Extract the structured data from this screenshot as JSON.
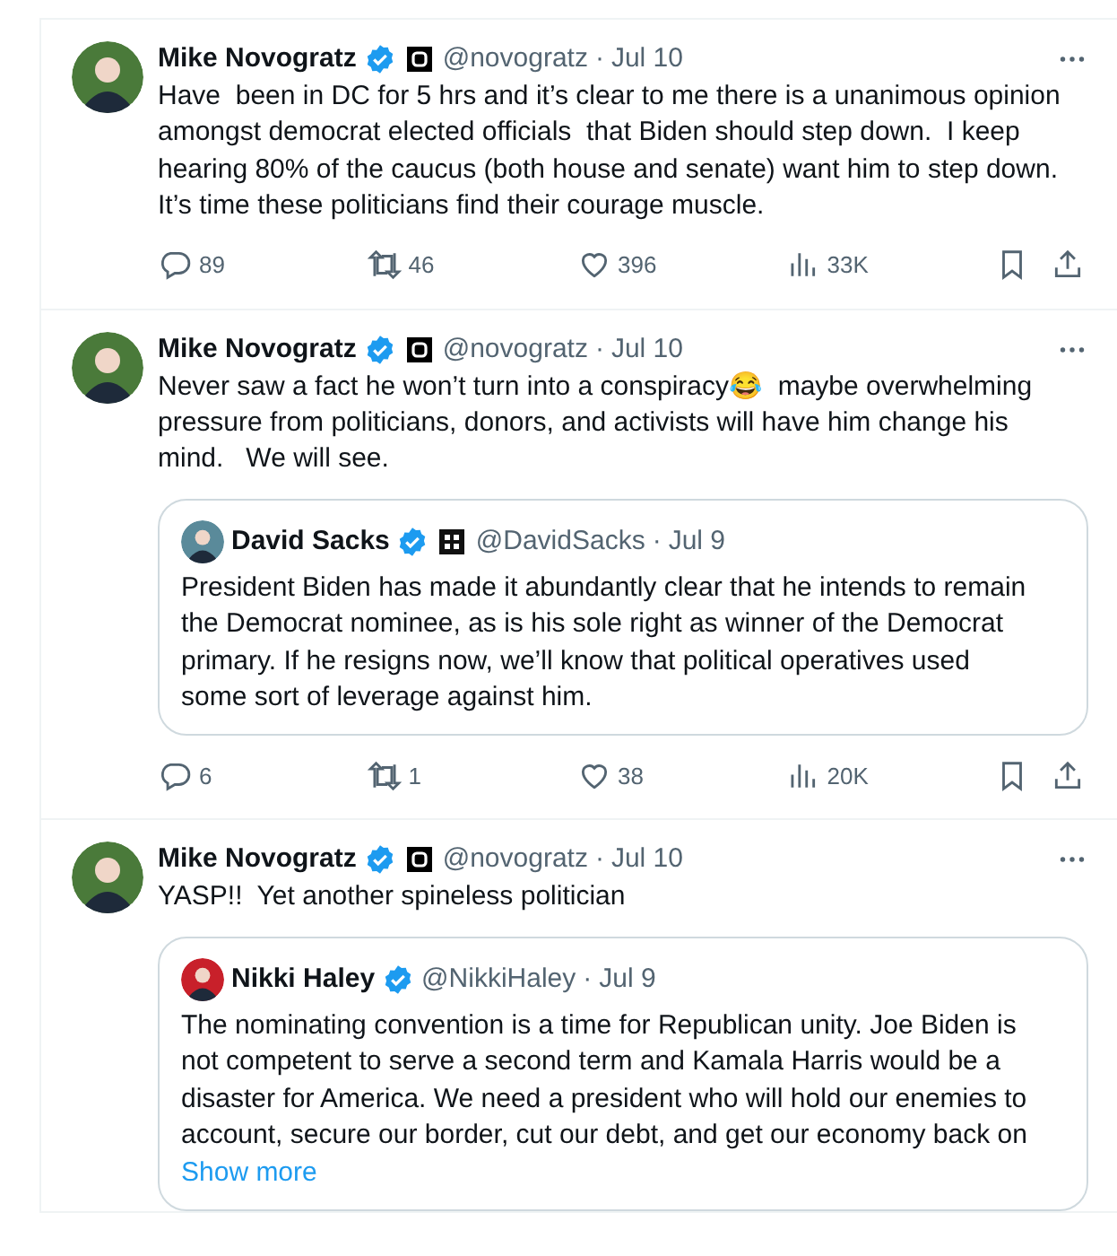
{
  "tweets": [
    {
      "author": {
        "name": "Mike Novogratz",
        "verified": true,
        "badge": {
          "kind": "square"
        },
        "handle": "@novogratz",
        "color": "#4a7a3a"
      },
      "dot": "·",
      "time": "Jul 10",
      "text": "Have  been in DC for 5 hrs and it’s clear to me there is a unanimous opinion amongst democrat elected officials  that Biden should step down.  I keep hearing 80% of the caucus (both house and senate) want him to step down. It’s time these politicians find their courage muscle.",
      "metrics": {
        "replies": "89",
        "reposts": "46",
        "likes": "396",
        "views": "33K"
      }
    },
    {
      "author": {
        "name": "Mike Novogratz",
        "verified": true,
        "badge": {
          "kind": "square"
        },
        "handle": "@novogratz",
        "color": "#4a7a3a"
      },
      "dot": "·",
      "time": "Jul 10",
      "text": "Never saw a fact he won’t turn into a conspiracy😂  maybe overwhelming pressure from politicians, donors, and activists will have him change his mind.   We will see.",
      "quote": {
        "author": {
          "name": "David Sacks",
          "verified": true,
          "badge": {
            "kind": "tile"
          },
          "handle": "@DavidSacks",
          "color": "#5a8a9a"
        },
        "dot": "·",
        "time": "Jul 9",
        "text": "President Biden has made it abundantly clear that he intends to remain the Democrat nominee, as is his sole right as winner of the Democrat primary. If he resigns now, we’ll know that political operatives used some sort of leverage against him."
      },
      "metrics": {
        "replies": "6",
        "reposts": "1",
        "likes": "38",
        "views": "20K"
      }
    },
    {
      "author": {
        "name": "Mike Novogratz",
        "verified": true,
        "badge": {
          "kind": "square"
        },
        "handle": "@novogratz",
        "color": "#4a7a3a"
      },
      "dot": "·",
      "time": "Jul 10",
      "text": "YASP!!  Yet another spineless politician",
      "quote": {
        "author": {
          "name": "Nikki Haley",
          "verified": true,
          "handle": "@NikkiHaley",
          "color": "#c8202a"
        },
        "dot": "·",
        "time": "Jul 9",
        "text": "The nominating convention is a time for Republican unity. Joe Biden is not competent to serve a second term and Kamala Harris would be a disaster for America. We need a president who will hold our enemies to account, secure our border, cut our debt, and get our economy back on",
        "show_more": "Show more"
      }
    }
  ]
}
